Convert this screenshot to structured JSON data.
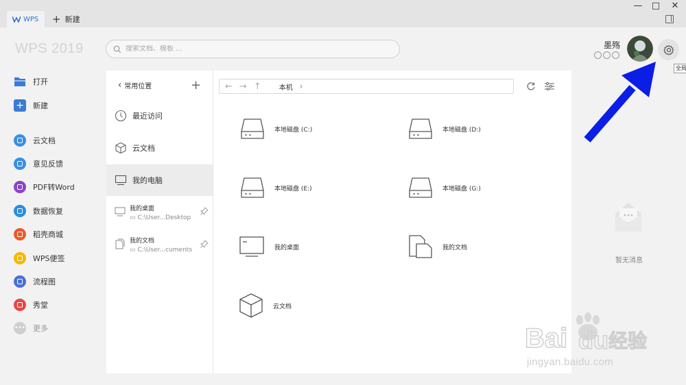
{
  "titlebar": {
    "tab_label": "WPS",
    "new_tab_label": "新建",
    "minimize": "—",
    "maximize": "□",
    "close": "✕"
  },
  "header": {
    "app_title": "WPS 2019",
    "search_placeholder": "搜索文档、模板 ...",
    "username": "墨殇",
    "tooltip": "全局设置"
  },
  "sidebar": {
    "items": [
      {
        "label": "打开",
        "icon": "folder-open-icon",
        "color": "#3a7bd5"
      },
      {
        "label": "新建",
        "icon": "plus-square-icon",
        "color": "#3a7bd5"
      },
      {
        "label": "云文档",
        "icon": "cloud-doc-icon",
        "color": "#3a8ee6"
      },
      {
        "label": "意见反馈",
        "icon": "feedback-icon",
        "color": "#3a8ee6"
      },
      {
        "label": "PDF转Word",
        "icon": "pdf-icon",
        "color": "#8b44c7"
      },
      {
        "label": "数据恢复",
        "icon": "data-recovery-icon",
        "color": "#2a8de0"
      },
      {
        "label": "稻壳商城",
        "icon": "docer-icon",
        "color": "#e85a2c"
      },
      {
        "label": "WPS便签",
        "icon": "note-icon",
        "color": "#f5b800"
      },
      {
        "label": "流程图",
        "icon": "flowchart-icon",
        "color": "#4a6fd6"
      },
      {
        "label": "秀堂",
        "icon": "xiutang-icon",
        "color": "#e84545"
      },
      {
        "label": "更多",
        "icon": "more-icon",
        "color": "#cfcfcf"
      }
    ]
  },
  "locations": {
    "header": "常用位置",
    "items": [
      {
        "label": "最近访问",
        "icon": "clock-icon"
      },
      {
        "label": "云文档",
        "icon": "cube-icon"
      },
      {
        "label": "我的电脑",
        "icon": "monitor-icon"
      }
    ],
    "favorites": [
      {
        "label": "我的桌面",
        "path": "C:\\User...Desktop"
      },
      {
        "label": "我的文档",
        "path": "C:\\User...cuments"
      }
    ]
  },
  "navbar": {
    "breadcrumb": "本机"
  },
  "drives": [
    {
      "label": "本地磁盘 (C:)",
      "icon": "hard-drive-icon"
    },
    {
      "label": "本地磁盘 (D:)",
      "icon": "hard-drive-icon"
    },
    {
      "label": "本地磁盘 (E:)",
      "icon": "hard-drive-icon"
    },
    {
      "label": "本地磁盘 (G:)",
      "icon": "hard-drive-icon"
    },
    {
      "label": "我的桌面",
      "icon": "desktop-icon"
    },
    {
      "label": "我的文档",
      "icon": "documents-icon"
    },
    {
      "label": "云文档",
      "icon": "cube-icon"
    }
  ],
  "messages": {
    "empty_text": "暂无消息"
  },
  "watermark": {
    "brand": "Bai du 经验",
    "url": "jingyan.baidu.com"
  },
  "annotation": {
    "arrow_color": "#0a1ee6"
  }
}
